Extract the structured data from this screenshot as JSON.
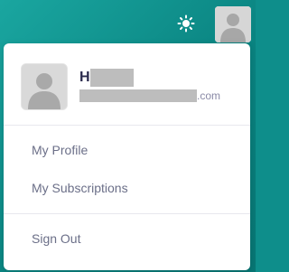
{
  "header": {
    "theme_toggle_icon": "sun-icon",
    "avatar_icon": "user-avatar-icon"
  },
  "menu": {
    "user": {
      "name_visible": "H",
      "email_visible": ".com",
      "avatar_icon": "user-avatar-icon"
    },
    "items": [
      {
        "label": "My Profile"
      },
      {
        "label": "My Subscriptions"
      }
    ],
    "sign_out_label": "Sign Out"
  },
  "colors": {
    "background": "#0e8e8b",
    "menu_background": "#ffffff",
    "name_text": "#2b2b4e",
    "item_text": "#6b6f88"
  }
}
